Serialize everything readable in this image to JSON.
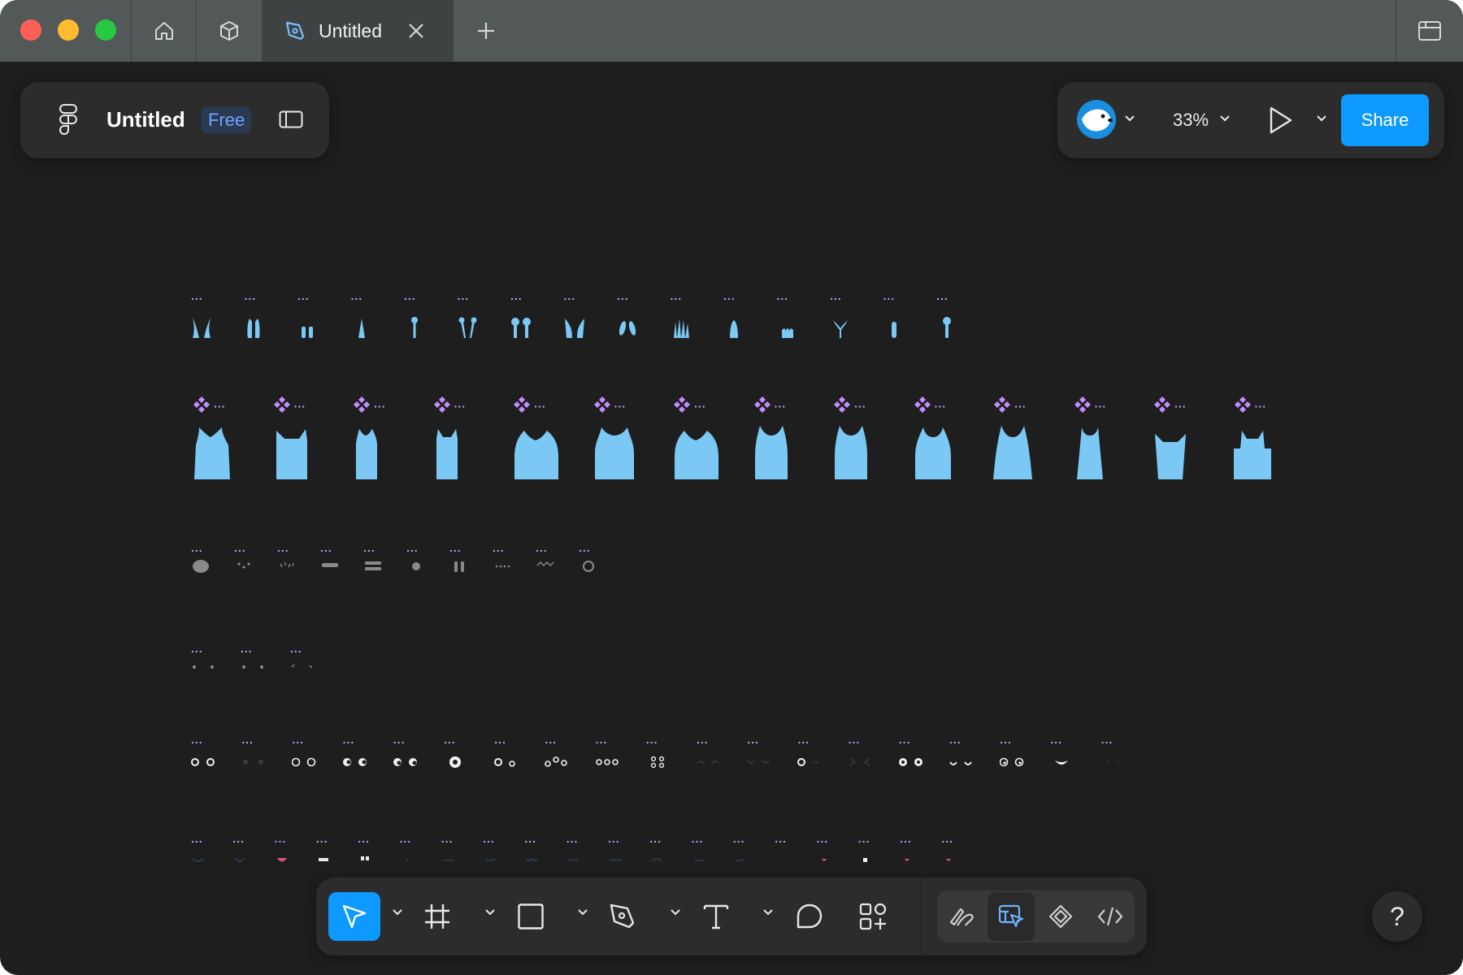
{
  "tabs": {
    "active_title": "Untitled"
  },
  "file": {
    "name": "Untitled",
    "plan_badge": "Free"
  },
  "top_right": {
    "zoom": "33%",
    "share_label": "Share"
  },
  "canvas": {
    "layer_label": "...",
    "rows": [
      {
        "name": "antenna-row",
        "count": 15
      },
      {
        "name": "body-row",
        "count": 14,
        "component": true
      },
      {
        "name": "marks-row-1",
        "count": 10
      },
      {
        "name": "marks-row-2",
        "count": 3
      },
      {
        "name": "eyes-row",
        "count": 19
      },
      {
        "name": "mouth-row",
        "count": 19
      }
    ]
  },
  "toolbar": {
    "tools": [
      "move-tool",
      "frame-tool",
      "rectangle-tool",
      "pen-tool",
      "text-tool",
      "comment-tool",
      "actions-tool"
    ],
    "modes": [
      "draw-mode",
      "design-mode",
      "dev-components-mode",
      "dev-mode"
    ]
  },
  "help": {
    "label": "?"
  },
  "colors": {
    "shape_fill": "#7cc8f5",
    "label_color": "#b4a0ff",
    "accent": "#0d99ff",
    "canvas_bg": "#1e1e1e"
  }
}
